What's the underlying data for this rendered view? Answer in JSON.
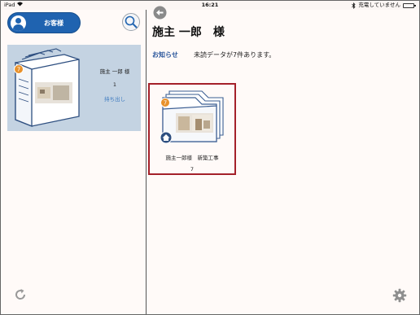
{
  "status_bar": {
    "carrier": "iPad",
    "wifi_icon": "wifi-icon",
    "time": "16:21",
    "charging_text": "充電していません",
    "bluetooth_icon": "bluetooth-icon",
    "battery_icon": "battery-icon"
  },
  "sidebar": {
    "customer_button_label": "お客様",
    "customer_card": {
      "name": "施主 一郎 様",
      "count": "1",
      "takeout_label": "持ち出し",
      "badge": "7"
    }
  },
  "main": {
    "title": "施主 一郎　様",
    "notice_label": "お知らせ",
    "notice_text": "未読データが7件あります。",
    "projects": [
      {
        "name": "施主一郎様　新築工事",
        "count": "7",
        "badge": "7"
      }
    ]
  },
  "colors": {
    "accent": "#1f63b0",
    "card_bg": "#c4d3e2",
    "selection_border": "#a4202a",
    "notice": "#2b579c",
    "badge": "#e8912b"
  }
}
